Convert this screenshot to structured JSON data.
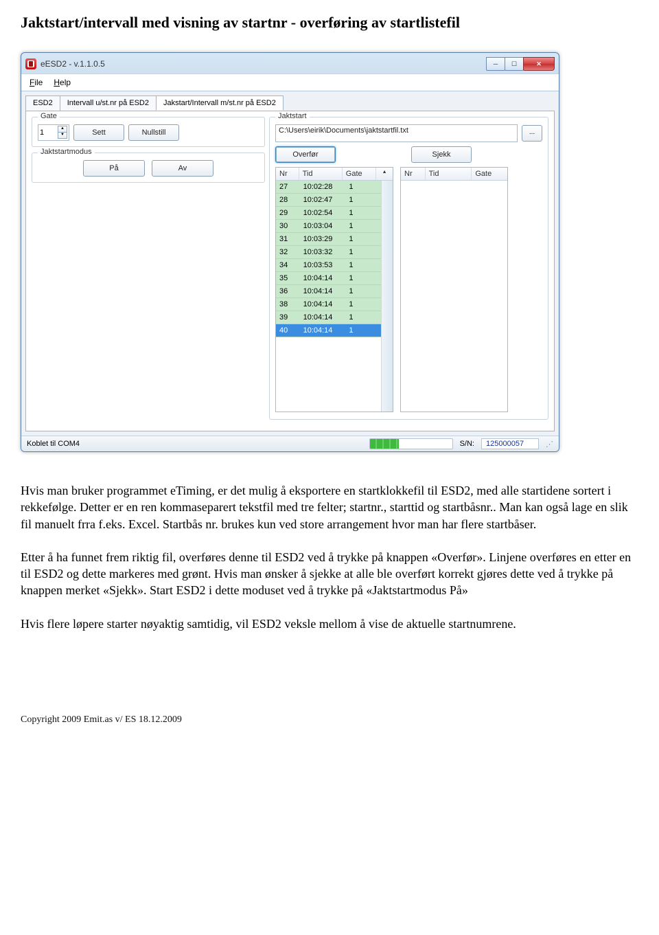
{
  "heading": "Jaktstart/intervall med visning av startnr - overføring av startlistefil",
  "window": {
    "title": "eESD2 - v.1.1.0.5",
    "menu": {
      "file_html": "<u>F</u>ile",
      "help_html": "<u>H</u>elp"
    },
    "tabs": {
      "t0": "ESD2",
      "t1": "Intervall u/st.nr på ESD2",
      "t2": "Jakstart/Intervall m/st.nr på ESD2"
    },
    "gate": {
      "legend": "Gate",
      "value": "1",
      "sett": "Sett",
      "nullstill": "Nullstill"
    },
    "jaktstart_group": {
      "legend": "Jaktstart",
      "path": "C:\\Users\\eirik\\Documents\\jaktstartfil.txt",
      "browse": "...",
      "overfor": "Overfør",
      "sjekk": "Sjekk",
      "headers": {
        "nr": "Nr",
        "tid": "Tid",
        "gate": "Gate"
      }
    },
    "jaktstartmodus": {
      "legend": "Jaktstartmodus",
      "on": "På",
      "off": "Av"
    },
    "status": {
      "conn": "Koblet til COM4",
      "sn_label": "S/N:",
      "sn_value": "125000057"
    },
    "rows": [
      {
        "nr": "27",
        "tid": "10:02:28",
        "gate": "1"
      },
      {
        "nr": "28",
        "tid": "10:02:47",
        "gate": "1"
      },
      {
        "nr": "29",
        "tid": "10:02:54",
        "gate": "1"
      },
      {
        "nr": "30",
        "tid": "10:03:04",
        "gate": "1"
      },
      {
        "nr": "31",
        "tid": "10:03:29",
        "gate": "1"
      },
      {
        "nr": "32",
        "tid": "10:03:32",
        "gate": "1"
      },
      {
        "nr": "34",
        "tid": "10:03:53",
        "gate": "1"
      },
      {
        "nr": "35",
        "tid": "10:04:14",
        "gate": "1"
      },
      {
        "nr": "36",
        "tid": "10:04:14",
        "gate": "1"
      },
      {
        "nr": "38",
        "tid": "10:04:14",
        "gate": "1"
      },
      {
        "nr": "39",
        "tid": "10:04:14",
        "gate": "1"
      },
      {
        "nr": "40",
        "tid": "10:04:14",
        "gate": "1"
      }
    ]
  },
  "paragraphs": {
    "p1": "Hvis man bruker programmet eTiming, er det mulig å eksportere en startklokkefil til ESD2, med alle startidene sortert i rekkefølge. Detter er en ren kommaseparert tekstfil med tre felter; startnr., starttid og startbåsnr.. Man kan også lage en slik fil manuelt frra f.eks. Excel. Startbås nr. brukes kun ved store arrangement hvor man har flere startbåser.",
    "p2": "Etter å ha funnet frem riktig fil, overføres denne til ESD2 ved å trykke på knappen «Overfør». Linjene overføres en etter en til ESD2 og dette markeres med grønt. Hvis man ønsker å sjekke at alle ble overført korrekt gjøres dette ved å trykke på knappen merket «Sjekk». Start ESD2 i dette moduset ved å trykke på «Jaktstartmodus På»",
    "p3": "Hvis flere løpere starter nøyaktig samtidig, vil ESD2 veksle mellom å vise de aktuelle startnumrene."
  },
  "footer": "Copyright 2009 Emit.as v/ ES    18.12.2009"
}
